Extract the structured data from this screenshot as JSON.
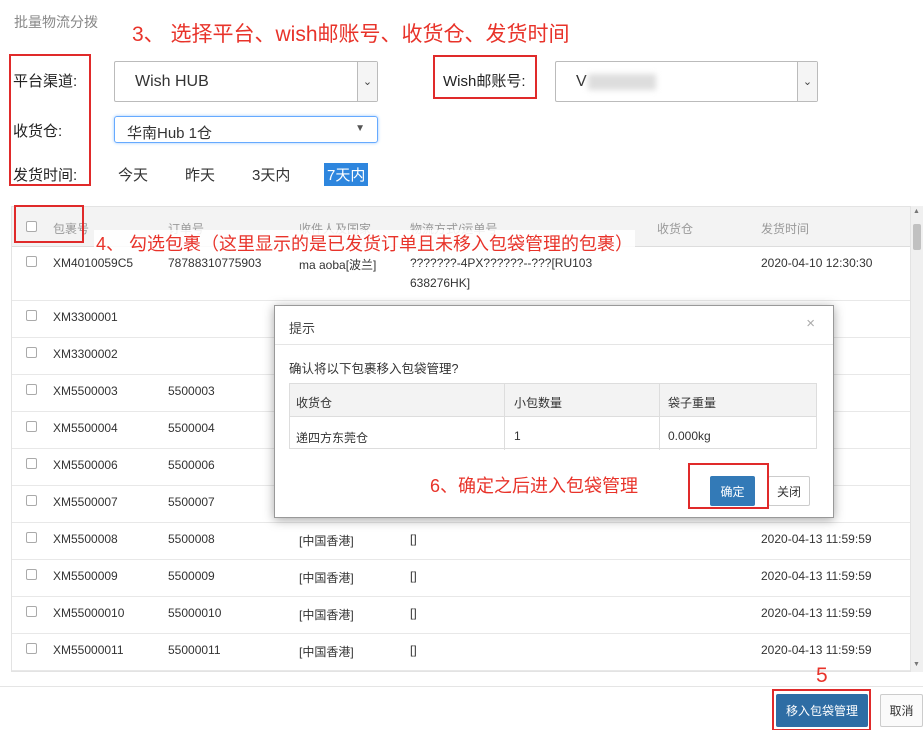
{
  "page": {
    "title": "批量物流分拨"
  },
  "annotations": {
    "step3": "3、 选择平台、wish邮账号、收货仓、发货时间",
    "step4": "4、 勾选包裹（这里显示的是已发货订单且未移入包袋管理的包裹）",
    "step5": "5",
    "step6": "6、确定之后进入包袋管理"
  },
  "filters": {
    "platform_label": "平台渠道:",
    "platform_value": "Wish HUB",
    "account_label": "Wish邮账号:",
    "account_value": "V",
    "warehouse_label": "收货仓:",
    "warehouse_value": "华南Hub 1仓",
    "time_label": "发货时间:",
    "time_options": [
      "今天",
      "昨天",
      "3天内",
      "7天内"
    ],
    "time_selected": "7天内"
  },
  "table": {
    "headers": [
      "包裹号",
      "订单号",
      "收件人及国家",
      "物流方式/运单号",
      "收货仓",
      "发货时间"
    ],
    "rows": [
      {
        "package": "XM4010059C5",
        "order": "78788310775903",
        "recipient": "ma aoba[波兰]",
        "logistics": "???????-4PX??????--???[RU103",
        "logistics2": "638276HK]",
        "warehouse": "",
        "time": "2020-04-10 12:30:30"
      },
      {
        "package": "XM3300001",
        "order": "",
        "recipient": "",
        "logistics": "",
        "logistics2": "",
        "warehouse": "",
        "time": ":59:59"
      },
      {
        "package": "XM3300002",
        "order": "",
        "recipient": "",
        "logistics": "",
        "logistics2": "",
        "warehouse": "",
        "time": ":59:59"
      },
      {
        "package": "XM5500003",
        "order": "5500003",
        "recipient": "",
        "logistics": "",
        "logistics2": "",
        "warehouse": "",
        "time": ":59:59"
      },
      {
        "package": "XM5500004",
        "order": "5500004",
        "recipient": "",
        "logistics": "",
        "logistics2": "",
        "warehouse": "",
        "time": ":59:59"
      },
      {
        "package": "XM5500006",
        "order": "5500006",
        "recipient": "",
        "logistics": "",
        "logistics2": "",
        "warehouse": "",
        "time": ":59:59"
      },
      {
        "package": "XM5500007",
        "order": "5500007",
        "recipient": "",
        "logistics": "",
        "logistics2": "",
        "warehouse": "",
        "time": ":59:59"
      },
      {
        "package": "XM5500008",
        "order": "5500008",
        "recipient": "[中国香港]",
        "logistics": "[]",
        "logistics2": "",
        "warehouse": "",
        "time": "2020-04-13 11:59:59"
      },
      {
        "package": "XM5500009",
        "order": "5500009",
        "recipient": "[中国香港]",
        "logistics": "[]",
        "logistics2": "",
        "warehouse": "",
        "time": "2020-04-13 11:59:59"
      },
      {
        "package": "XM55000010",
        "order": "55000010",
        "recipient": "[中国香港]",
        "logistics": "[]",
        "logistics2": "",
        "warehouse": "",
        "time": "2020-04-13 11:59:59"
      },
      {
        "package": "XM55000011",
        "order": "55000011",
        "recipient": "[中国香港]",
        "logistics": "[]",
        "logistics2": "",
        "warehouse": "",
        "time": "2020-04-13 11:59:59"
      }
    ]
  },
  "dialog": {
    "title": "提示",
    "close": "×",
    "message": "确认将以下包裹移入包袋管理?",
    "headers": [
      "收货仓",
      "小包数量",
      "袋子重量"
    ],
    "row": [
      "递四方东莞仓",
      "1",
      "0.000kg"
    ],
    "confirm": "确定",
    "cancel": "关闭"
  },
  "footer": {
    "move_button": "移入包袋管理",
    "cancel_button": "取消"
  },
  "colors": {
    "annotation": "#e8332a",
    "primary": "#337ab7",
    "selected_time": "#2e86de"
  }
}
